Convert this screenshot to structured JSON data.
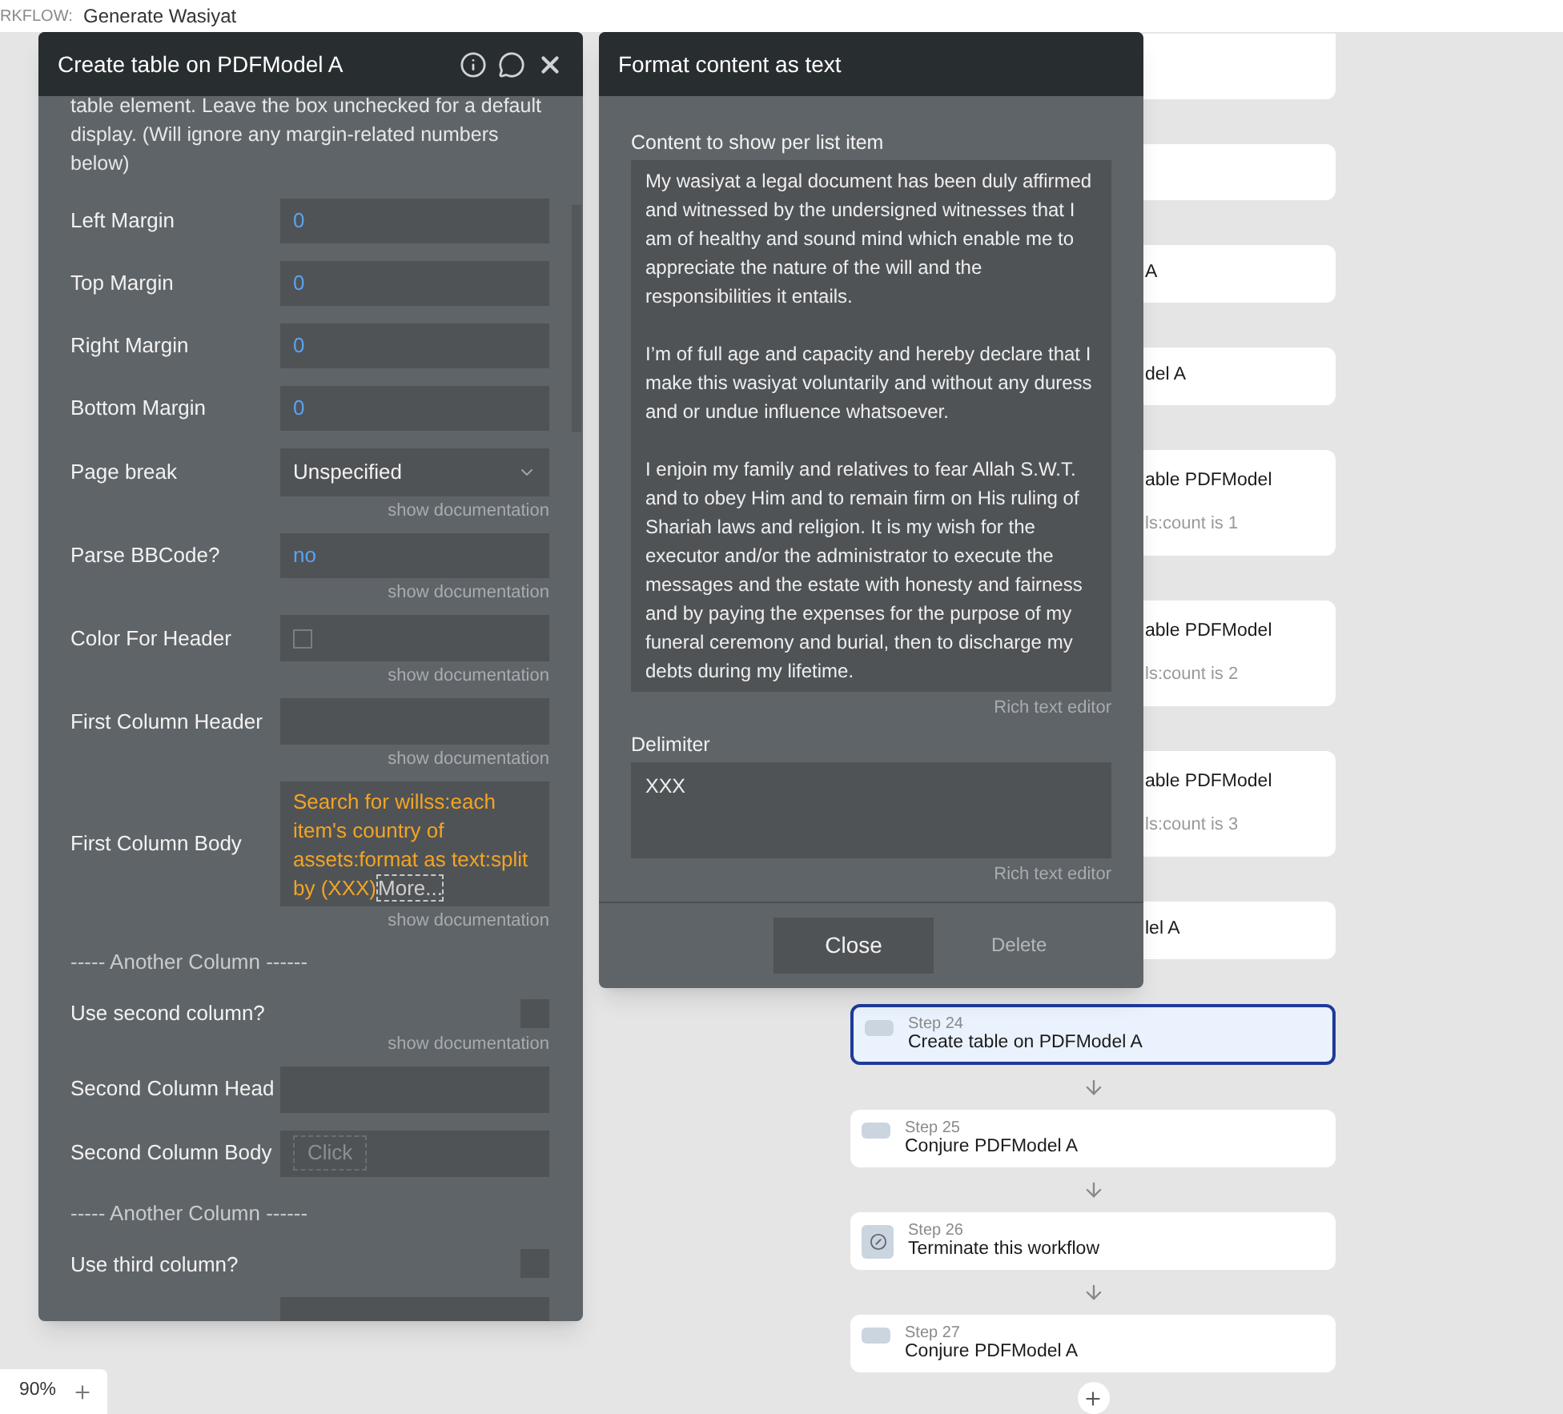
{
  "topbar": {
    "label": "RKFLOW:",
    "workflow": "Generate Wasiyat"
  },
  "left_panel": {
    "title": "Create table on PDFModel A",
    "intro": "table element. Leave the box unchecked for a default display. (Will ignore any margin-related numbers below)",
    "fields": [
      {
        "kind": "value",
        "label": "Left Margin",
        "value": "0"
      },
      {
        "kind": "value",
        "label": "Top Margin",
        "value": "0"
      },
      {
        "kind": "value",
        "label": "Right Margin",
        "value": "0"
      },
      {
        "kind": "value",
        "label": "Bottom Margin",
        "value": "0"
      },
      {
        "kind": "dropdown",
        "label": "Page break",
        "value": "Unspecified",
        "doc": "show documentation"
      },
      {
        "kind": "value",
        "label": "Parse BBCode?",
        "value": "no",
        "doc": "show documentation"
      },
      {
        "kind": "checkbox",
        "label": "Color For Header",
        "checked": false,
        "doc": "show documentation"
      },
      {
        "kind": "empty",
        "label": "First Column Header",
        "doc": "show documentation"
      },
      {
        "kind": "expression",
        "label": "First Column Body",
        "value": "Search for willss:each item's country of assets:format as text:split by (XXX)",
        "more": "More...",
        "doc": "show documentation"
      },
      {
        "kind": "separator",
        "label": "----- Another Column ------"
      },
      {
        "kind": "toggle",
        "label": "Use second column?",
        "checked": false,
        "doc": "show documentation"
      },
      {
        "kind": "empty",
        "label": "Second Column Head"
      },
      {
        "kind": "click",
        "label": "Second Column Body",
        "placeholder": "Click"
      },
      {
        "kind": "separator",
        "label": "----- Another Column ------"
      },
      {
        "kind": "toggle",
        "label": "Use third column?",
        "checked": false
      },
      {
        "kind": "empty"
      }
    ]
  },
  "format_panel": {
    "title": "Format content as text",
    "content_label": "Content to show per list item",
    "content": [
      "My wasiyat a legal document has been duly affirmed and witnessed by the undersigned witnesses that I am of healthy and sound mind which enable me to appreciate the nature of the will and the responsibilities it entails.",
      "I’m of full age and capacity and hereby declare that I make this wasiyat voluntarily and without any duress and or undue influence whatsoever.",
      "I enjoin my family and relatives to fear Allah S.W.T. and to obey Him and to remain firm on His ruling of Shariah laws and religion. It is my wish for the executor and/or the administrator to execute the messages and the estate with honesty and fairness and by paying the expenses for the purpose of my funeral ceremony and burial, then to discharge my debts during my lifetime."
    ],
    "content_link": "Rich text editor",
    "delimiter_label": "Delimiter",
    "delimiter": "XXX",
    "delimiter_link": "Rich text editor",
    "buttons": [
      {
        "label": "Close",
        "kind": "primary"
      },
      {
        "label": "Delete",
        "kind": "plain"
      }
    ]
  },
  "steps": [
    {
      "kind": "covered"
    },
    {
      "kind": "covered"
    },
    {
      "kind": "covered",
      "lines": [
        "A"
      ]
    },
    {
      "kind": "covered",
      "lines": [
        "del A"
      ]
    },
    {
      "kind": "covered",
      "lines": [
        "able PDFModel",
        "ls:count is 1"
      ]
    },
    {
      "kind": "covered",
      "lines": [
        "able PDFModel",
        "ls:count is 2"
      ]
    },
    {
      "kind": "covered",
      "lines": [
        "able PDFModel",
        "ls:count is 3"
      ]
    },
    {
      "kind": "covered",
      "lines": [
        "lel A"
      ]
    },
    {
      "kind": "step",
      "step": "Step 24",
      "title": "Create table on PDFModel A",
      "selected": true
    },
    {
      "kind": "step",
      "step": "Step 25",
      "title": "Conjure PDFModel A",
      "selected": false
    },
    {
      "kind": "terminate",
      "step": "Step 26",
      "title": "Terminate this workflow",
      "selected": false
    },
    {
      "kind": "step",
      "step": "Step 27",
      "title": "Conjure PDFModel A",
      "selected": false
    }
  ],
  "zoom": {
    "value": "90%"
  }
}
